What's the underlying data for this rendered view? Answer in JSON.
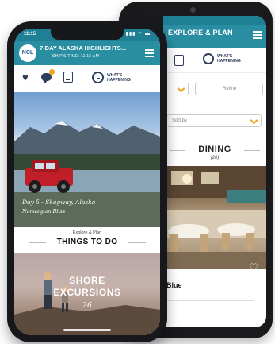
{
  "back_phone": {
    "header_title": "EXPLORE & PLAN",
    "whats_happening": "WHAT'S\nHAPPENING",
    "filter_placeholder": "Refine",
    "sort_placeholder": "Sort by",
    "section_title": "DINING",
    "section_count": "(20)",
    "card_title": "Blue"
  },
  "front_phone": {
    "status_time": "11:15",
    "status_icons": "▮▮▮ ◠ ▬",
    "logo_text": "NCL",
    "header_title": "7-DAY ALASKA HIGHLIGHTS...",
    "header_sub": "SHIP'S TIME: 11:15 AM",
    "whats_happening": "WHAT'S\nHAPPENING",
    "hero_caption": "Day 5 - Skagway, Alaska",
    "hero_sub": "Norwegian Bliss",
    "explore_kicker": "Explore & Plan",
    "explore_title": "THINGS TO DO",
    "shore_title": "SHORE\nEXCURSIONS",
    "shore_count": "26"
  },
  "colors": {
    "header_teal": "#2a8ea3",
    "status_teal": "#1f7f95",
    "accent_orange": "#f2a31b",
    "icon_navy": "#2b3d5b",
    "phone_body": "#17181b"
  },
  "icons": [
    "heart-icon",
    "chat-icon",
    "itinerary-icon",
    "clock-icon",
    "menu-icon",
    "chevron-down-icon"
  ]
}
